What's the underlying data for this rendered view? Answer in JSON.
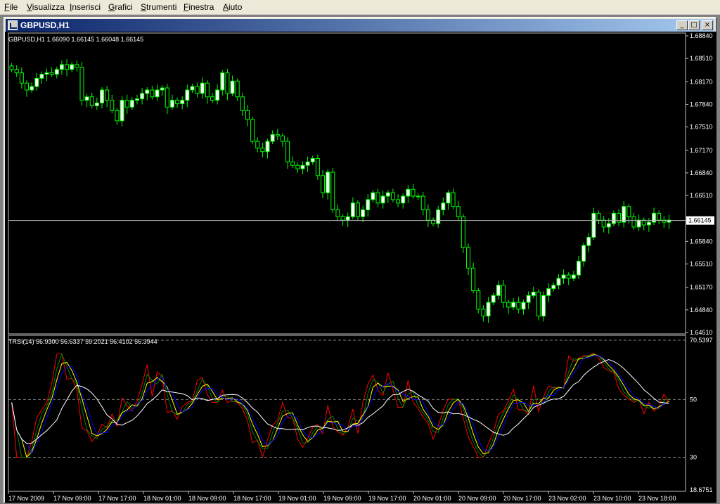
{
  "menu": [
    {
      "label": "File",
      "ul": "F",
      "rest": "ile"
    },
    {
      "label": "Visualizza",
      "ul": "V",
      "rest": "isualizza"
    },
    {
      "label": "Inserisci",
      "ul": "I",
      "rest": "nserisci"
    },
    {
      "label": "Grafici",
      "ul": "G",
      "rest": "rafici"
    },
    {
      "label": "Strumenti",
      "ul": "S",
      "rest": "trumenti"
    },
    {
      "label": "Finestra",
      "ul": "F",
      "rest": "inestra"
    },
    {
      "label": "Aiuto",
      "ul": "A",
      "rest": "iuto"
    }
  ],
  "window": {
    "title": "GBPUSD,H1",
    "min_glyph": "_",
    "max_glyph": "□",
    "close_glyph": "×"
  },
  "chart": {
    "header": "GBPUSD,H1  1.66090 1.66145 1.66048 1.66145",
    "current_price": "1.66145",
    "price_ticks": [
      "1.68840",
      "1.68510",
      "1.68170",
      "1.67840",
      "1.67510",
      "1.67170",
      "1.66840",
      "1.66510",
      "1.66145",
      "1.65840",
      "1.65510",
      "1.65170",
      "1.64840",
      "1.64510"
    ],
    "indicator_header": "TRSI(14) 56.9300 56.6337 59.2021 56.4102 56.3944",
    "indicator_ticks": [
      "70.5397",
      "50",
      "30",
      "18.6751"
    ],
    "time_labels": [
      "17 Nov 2009",
      "17 Nov 09:00",
      "17 Nov 17:00",
      "18 Nov 01:00",
      "18 Nov 09:00",
      "18 Nov 17:00",
      "19 Nov 01:00",
      "19 Nov 09:00",
      "19 Nov 17:00",
      "20 Nov 01:00",
      "20 Nov 09:00",
      "20 Nov 17:00",
      "23 Nov 02:00",
      "23 Nov 10:00",
      "23 Nov 18:00"
    ],
    "colors": {
      "background": "#000000",
      "candle": "#00ff00",
      "up_body": "#ffffff",
      "down_body": "#000000",
      "axis": "#c0c0c0"
    }
  },
  "chart_data": {
    "type": "candlestick",
    "symbol": "GBPUSD",
    "timeframe": "H1",
    "ylim": [
      1.6451,
      1.6884
    ],
    "close": [
      1.6835,
      1.683,
      1.6815,
      1.6805,
      1.681,
      1.6822,
      1.6828,
      1.683,
      1.6828,
      1.6835,
      1.6842,
      1.6835,
      1.6842,
      1.6838,
      1.679,
      1.6795,
      1.6782,
      1.6786,
      1.6805,
      1.679,
      1.6775,
      1.676,
      1.679,
      1.678,
      1.679,
      1.6792,
      1.68,
      1.6805,
      1.6795,
      1.6805,
      1.6808,
      1.678,
      1.679,
      1.6785,
      1.679,
      1.6805,
      1.681,
      1.68,
      1.6815,
      1.6795,
      1.679,
      1.6805,
      1.683,
      1.68,
      1.6818,
      1.6795,
      1.6775,
      1.6762,
      1.673,
      1.672,
      1.6715,
      1.673,
      1.674,
      1.6738,
      1.673,
      1.67,
      1.6695,
      1.669,
      1.6695,
      1.67,
      1.6705,
      1.668,
      1.6655,
      1.6685,
      1.663,
      1.662,
      1.6615,
      1.662,
      1.664,
      1.662,
      1.663,
      1.6645,
      1.6655,
      1.664,
      1.665,
      1.6655,
      1.6645,
      1.664,
      1.665,
      1.666,
      1.665,
      1.665,
      1.663,
      1.6615,
      1.661,
      1.663,
      1.664,
      1.6655,
      1.6635,
      1.662,
      1.6575,
      1.6545,
      1.6512,
      1.6485,
      1.6475,
      1.6495,
      1.6505,
      1.652,
      1.6495,
      1.6488,
      1.6495,
      1.6485,
      1.6495,
      1.6505,
      1.651,
      1.6475,
      1.6505,
      1.6515,
      1.652,
      1.653,
      1.6535,
      1.653,
      1.6535,
      1.6555,
      1.6578,
      1.659,
      1.6625,
      1.6615,
      1.6605,
      1.661,
      1.6625,
      1.6612,
      1.6635,
      1.662,
      1.6605,
      1.6615,
      1.6608,
      1.6612,
      1.6625,
      1.6615,
      1.6612,
      1.6615
    ],
    "indicator": {
      "name": "TRSI(14)",
      "values": [
        56.93,
        56.6337,
        59.2021,
        56.4102,
        56.3944
      ],
      "levels": [
        50,
        30
      ],
      "ylim": [
        18.6751,
        70.5397
      ]
    }
  }
}
